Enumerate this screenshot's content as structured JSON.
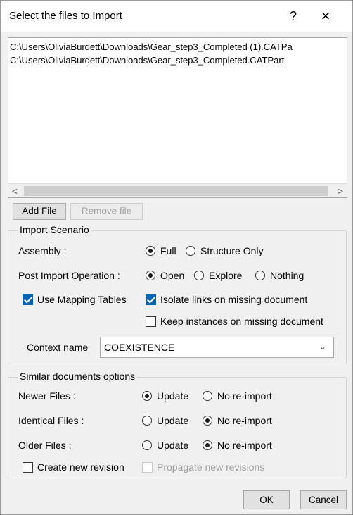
{
  "window": {
    "title": "Select the files to Import",
    "help_glyph": "?",
    "close_glyph": "×"
  },
  "file_list": {
    "items": [
      "C:\\Users\\OliviaBurdett\\Downloads\\Gear_step3_Completed (1).CATPa",
      "C:\\Users\\OliviaBurdett\\Downloads\\Gear_step3_Completed.CATPart"
    ],
    "scroll_left": "<",
    "scroll_right": ">"
  },
  "file_buttons": {
    "add": "Add File",
    "remove": "Remove file"
  },
  "import_scenario": {
    "legend": "Import Scenario",
    "assembly_label": "Assembly :",
    "assembly_options": {
      "full": "Full",
      "structure_only": "Structure Only"
    },
    "assembly_selected": "Full",
    "post_import_label": "Post Import Operation :",
    "post_import_options": {
      "open": "Open",
      "explore": "Explore",
      "nothing": "Nothing"
    },
    "post_import_selected": "Open",
    "use_mapping_tables": "Use Mapping Tables",
    "use_mapping_tables_checked": true,
    "isolate_links": "Isolate links on missing document",
    "isolate_links_checked": true,
    "keep_instances": "Keep instances on missing document",
    "keep_instances_checked": false,
    "context_label": "Context name",
    "context_value": "COEXISTENCE"
  },
  "similar_docs": {
    "legend": "Similar documents options",
    "rows": [
      {
        "label": "Newer Files :",
        "selected": "Update"
      },
      {
        "label": "Identical Files :",
        "selected": "No re-import"
      },
      {
        "label": "Older Files :",
        "selected": "No re-import"
      }
    ],
    "opt_update": "Update",
    "opt_no_reimport": "No re-import",
    "create_new_revision": "Create new revision",
    "propagate_new_revisions": "Propagate new revisions"
  },
  "footer": {
    "ok": "OK",
    "cancel": "Cancel"
  }
}
